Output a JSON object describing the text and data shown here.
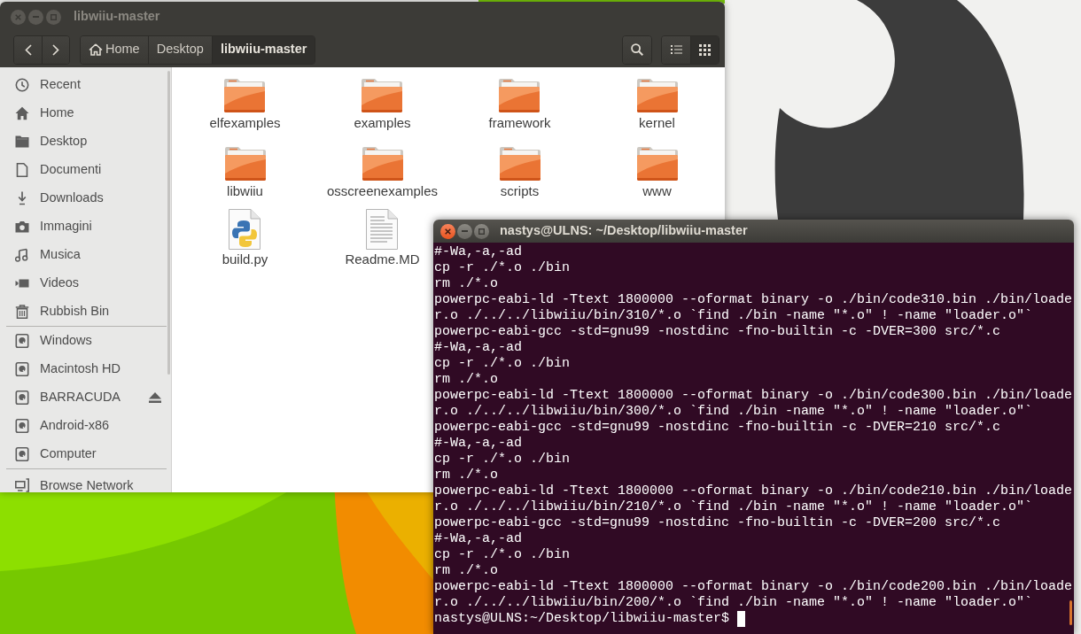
{
  "file_manager": {
    "title": "libwiiu-master",
    "focused": false,
    "breadcrumbs": [
      {
        "label": "Home",
        "kind": "home",
        "selected": false
      },
      {
        "label": "Desktop",
        "kind": "folder",
        "selected": false
      },
      {
        "label": "libwiiu-master",
        "kind": "folder",
        "selected": true
      }
    ],
    "view_buttons": [
      {
        "kind": "list",
        "selected": false
      },
      {
        "kind": "grid",
        "selected": true
      }
    ],
    "sidebar": {
      "sections": [
        {
          "items": [
            {
              "label": "Recent",
              "kind": "recent",
              "ejectable": false
            },
            {
              "label": "Home",
              "kind": "home",
              "ejectable": false
            },
            {
              "label": "Desktop",
              "kind": "desktop",
              "ejectable": false
            },
            {
              "label": "Documenti",
              "kind": "documents",
              "ejectable": false
            },
            {
              "label": "Downloads",
              "kind": "downloads",
              "ejectable": false
            },
            {
              "label": "Immagini",
              "kind": "pictures",
              "ejectable": false
            },
            {
              "label": "Musica",
              "kind": "music",
              "ejectable": false
            },
            {
              "label": "Videos",
              "kind": "videos",
              "ejectable": false
            },
            {
              "label": "Rubbish Bin",
              "kind": "trash",
              "ejectable": false
            }
          ]
        },
        {
          "items": [
            {
              "label": "Windows",
              "kind": "drive",
              "ejectable": false
            },
            {
              "label": "Macintosh HD",
              "kind": "drive",
              "ejectable": false
            },
            {
              "label": "BARRACUDA",
              "kind": "drive",
              "ejectable": true
            },
            {
              "label": "Android-x86",
              "kind": "drive",
              "ejectable": false
            },
            {
              "label": "Computer",
              "kind": "drive",
              "ejectable": false
            }
          ]
        },
        {
          "items": [
            {
              "label": "Browse Network",
              "kind": "network",
              "ejectable": false
            }
          ]
        }
      ]
    },
    "files": [
      {
        "name": "elfexamples",
        "kind": "folder"
      },
      {
        "name": "examples",
        "kind": "folder"
      },
      {
        "name": "framework",
        "kind": "folder"
      },
      {
        "name": "kernel",
        "kind": "folder"
      },
      {
        "name": "libwiiu",
        "kind": "folder"
      },
      {
        "name": "osscreenexamples",
        "kind": "folder"
      },
      {
        "name": "scripts",
        "kind": "folder"
      },
      {
        "name": "www",
        "kind": "folder"
      },
      {
        "name": "build.py",
        "kind": "python"
      },
      {
        "name": "Readme.MD",
        "kind": "text"
      }
    ]
  },
  "terminal": {
    "title": "nastys@ULNS: ~/Desktop/libwiiu-master",
    "focused": true,
    "lines": [
      "#-Wa,-a,-ad",
      "cp -r ./*.o ./bin",
      "rm ./*.o",
      "powerpc-eabi-ld -Ttext 1800000 --oformat binary -o ./bin/code310.bin ./bin/loade",
      "r.o ./../../libwiiu/bin/310/*.o `find ./bin -name \"*.o\" ! -name \"loader.o\"`",
      "powerpc-eabi-gcc -std=gnu99 -nostdinc -fno-builtin -c -DVER=300 src/*.c",
      "#-Wa,-a,-ad",
      "cp -r ./*.o ./bin",
      "rm ./*.o",
      "powerpc-eabi-ld -Ttext 1800000 --oformat binary -o ./bin/code300.bin ./bin/loade",
      "r.o ./../../libwiiu/bin/300/*.o `find ./bin -name \"*.o\" ! -name \"loader.o\"`",
      "powerpc-eabi-gcc -std=gnu99 -nostdinc -fno-builtin -c -DVER=210 src/*.c",
      "#-Wa,-a,-ad",
      "cp -r ./*.o ./bin",
      "rm ./*.o",
      "powerpc-eabi-ld -Ttext 1800000 --oformat binary -o ./bin/code210.bin ./bin/loade",
      "r.o ./../../libwiiu/bin/210/*.o `find ./bin -name \"*.o\" ! -name \"loader.o\"`",
      "powerpc-eabi-gcc -std=gnu99 -nostdinc -fno-builtin -c -DVER=200 src/*.c",
      "#-Wa,-a,-ad",
      "cp -r ./*.o ./bin",
      "rm ./*.o",
      "powerpc-eabi-ld -Ttext 1800000 --oformat binary -o ./bin/code200.bin ./bin/loade",
      "r.o ./../../libwiiu/bin/200/*.o `find ./bin -name \"*.o\" ! -name \"loader.o\"`"
    ],
    "prompt": "nastys@ULNS:~/Desktop/libwiiu-master$"
  }
}
